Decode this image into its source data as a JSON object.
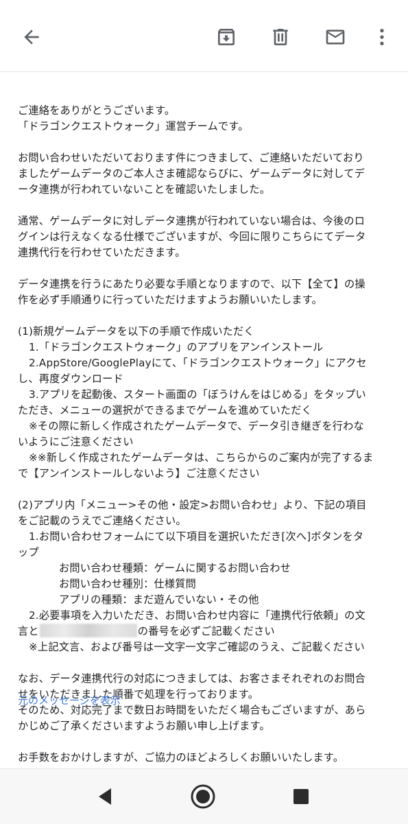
{
  "toolbar": {
    "back_icon": "arrow-back-icon",
    "archive_icon": "archive-icon",
    "delete_icon": "trash-icon",
    "mail_icon": "mail-icon",
    "more_icon": "more-vertical-icon"
  },
  "email": {
    "p1": [
      "ご連絡をありがとうございます。",
      "「ドラゴンクエストウォーク」運営チームです。"
    ],
    "p2": [
      "お問い合わせいただいております件につきまして、ご連絡いただいており",
      "ましたゲームデータのご本人さま確認ならびに、ゲームデータに対してデ",
      "ータ連携が行われていないことを確認いたしました。"
    ],
    "p3": [
      "通常、ゲームデータに対しデータ連携が行われていない場合は、今後のロ",
      "グインは行えなくなる仕様でございますが、今回に限りこちらにてデータ",
      "連携代行を行わせていただきます。"
    ],
    "p4": [
      "データ連携を行うにあたり必要な手順となりますので、以下【全て】の操",
      "作を必ず手順通りに行っていただけますようお願いいたします。"
    ],
    "s1": {
      "heading": "(1)新規ゲームデータを以下の手順で作成いただく",
      "step1": "1.「ドラゴンクエストウォーク」のアプリをアンインストール",
      "step2a": "2.AppStore/GooglePlayにて、「ドラゴンクエストウォーク」にアクセ",
      "step2b": "し、再度ダウンロード",
      "step3a": "3.アプリを起動後、スタート画面の「ぼうけんをはじめる」をタップい",
      "step3b": "ただき、メニューの選択ができるまでゲームを進めていただく",
      "note1a": "※その際に新しく作成されたゲームデータで、データ引き継ぎを行わな",
      "note1b": "いようにご注意ください",
      "note2a": "※※新しく作成されたゲームデータは、こちらからのご案内が完了するま",
      "note2b": "で【アンインストールしないよう】ご注意ください"
    },
    "s2": {
      "heading_a": "(2)アプリ内「メニュー>その他・設定>お問い合わせ」より、下記の項目",
      "heading_b": "をご記載のうえでご連絡ください。",
      "step1a": "1.お問い合わせフォームにて以下項目を選択いただき[次へ]ボタンをタ",
      "step1b": "ップ",
      "field1": "お問い合わせ種類：ゲームに関するお問い合わせ",
      "field2": "お問い合わせ種別：仕様質問",
      "field3": "アプリの種類：まだ遊んでいない・その他",
      "step2a": "2.必要事項を入力いただき、お問い合わせ内容に「連携代行依頼」の文",
      "step2b_start": "言と",
      "step2b_end": "の番号を必ずご記載ください",
      "note": "※上記文言、および番号は一文字一文字ご確認のうえ、ご記載ください"
    },
    "p5": [
      "なお、データ連携代行の対応につきましては、お客さまそれぞれのお問合",
      "せをいただきました順番で処理を行っております。",
      "そのため、対応完了まで数日お時間をいただく場合もございますが、あら",
      "かじめご了承くださいますようお願い申し上げます。"
    ],
    "p6": "お手数をおかけしますが、ご協力のほどよろしくお願いいたします。",
    "view_original": "元のメッセージを表示"
  },
  "navbar": {
    "back_icon": "nav-back-triangle-icon",
    "home_icon": "nav-home-circle-icon",
    "recent_icon": "nav-recents-square-icon"
  },
  "colors": {
    "link": "#3c78d8",
    "icon": "#5f6368",
    "text": "#202124"
  }
}
